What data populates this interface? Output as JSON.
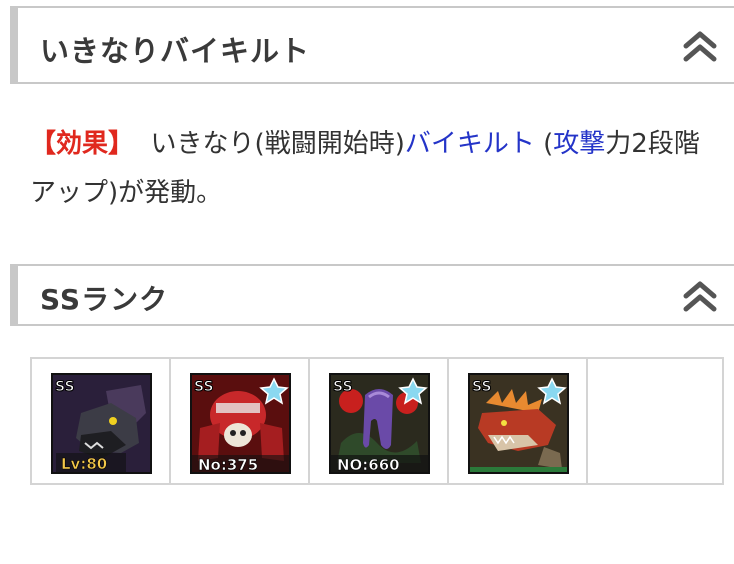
{
  "sections": [
    {
      "title": "いきなりバイキルト",
      "collapse_icon": "double-chevron-up-icon"
    },
    {
      "title": "SSランク",
      "collapse_icon": "double-chevron-up-icon"
    }
  ],
  "effect": {
    "tag": "【効果】",
    "text_1": "いきなり(戦闘開始時)",
    "link_1": "バイキルト",
    "text_2": " (",
    "link_2": "攻撃",
    "text_3": "力2段階アップ)が発動。"
  },
  "monsters": [
    {
      "rank": "SS",
      "badge": "Lv:80",
      "star": false,
      "icon": "dark-wolf-monster-icon"
    },
    {
      "rank": "SS",
      "badge": "No:375",
      "star": true,
      "icon": "red-armored-skull-monster-icon"
    },
    {
      "rank": "SS",
      "badge": "NO:660",
      "star": true,
      "icon": "purple-tentacle-monster-icon"
    },
    {
      "rank": "SS",
      "badge": "",
      "star": true,
      "icon": "red-dragon-monster-icon"
    }
  ],
  "colors": {
    "header_border": "#c8c8c8",
    "effect_tag": "#e0281e",
    "link": "#2434c8",
    "text": "#333333"
  }
}
